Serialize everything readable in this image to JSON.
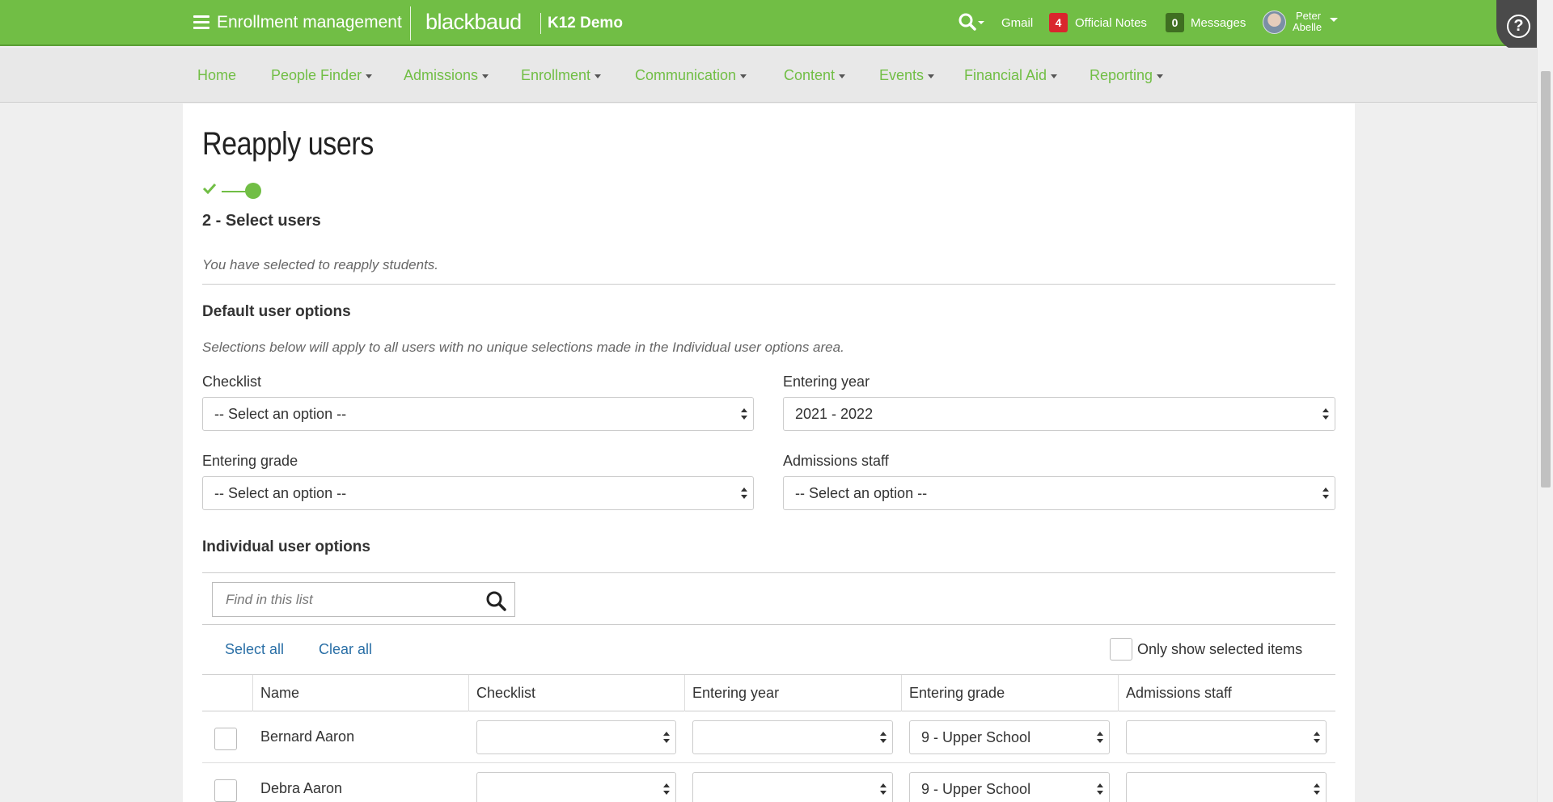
{
  "header": {
    "app_title": "Enrollment management",
    "brand": "blackbaud",
    "brand_sub": "K12 Demo",
    "gmail": "Gmail",
    "notes_count": "4",
    "notes_label": "Official Notes",
    "messages_count": "0",
    "messages_label": "Messages",
    "user_first": "Peter",
    "user_last": "Abelle",
    "help_symbol": "?",
    "colors": {
      "brand_green": "#71be45",
      "notes_badge": "#d9262d",
      "messages_badge": "#3f6f21"
    }
  },
  "nav": {
    "items": [
      {
        "label": "Home",
        "dropdown": false
      },
      {
        "label": "People Finder",
        "dropdown": true
      },
      {
        "label": "Admissions",
        "dropdown": true
      },
      {
        "label": "Enrollment",
        "dropdown": true
      },
      {
        "label": "Communication",
        "dropdown": true
      },
      {
        "label": "Content",
        "dropdown": true
      },
      {
        "label": "Events",
        "dropdown": true
      },
      {
        "label": "Financial Aid",
        "dropdown": true
      },
      {
        "label": "Reporting",
        "dropdown": true
      }
    ]
  },
  "page": {
    "title": "Reapply users",
    "step_label": "2 - Select users",
    "info": "You have selected to reapply students."
  },
  "defaults": {
    "title": "Default user options",
    "description": "Selections below will apply to all users with no unique selections made in the Individual user options area.",
    "checklist_label": "Checklist",
    "checklist_value": "-- Select an option --",
    "entering_year_label": "Entering year",
    "entering_year_value": "2021 - 2022",
    "entering_grade_label": "Entering grade",
    "entering_grade_value": "-- Select an option --",
    "admissions_staff_label": "Admissions staff",
    "admissions_staff_value": "-- Select an option --"
  },
  "individual": {
    "title": "Individual user options",
    "search_placeholder": "Find in this list",
    "select_all": "Select all",
    "clear_all": "Clear all",
    "only_selected": "Only show selected items",
    "columns": [
      "Name",
      "Checklist",
      "Entering year",
      "Entering grade",
      "Admissions staff"
    ],
    "rows": [
      {
        "name": "Bernard Aaron",
        "checklist": "",
        "entering_year": "",
        "entering_grade": "9 - Upper School",
        "admissions_staff": ""
      },
      {
        "name": "Debra Aaron",
        "checklist": "",
        "entering_year": "",
        "entering_grade": "9 - Upper School",
        "admissions_staff": ""
      }
    ]
  }
}
